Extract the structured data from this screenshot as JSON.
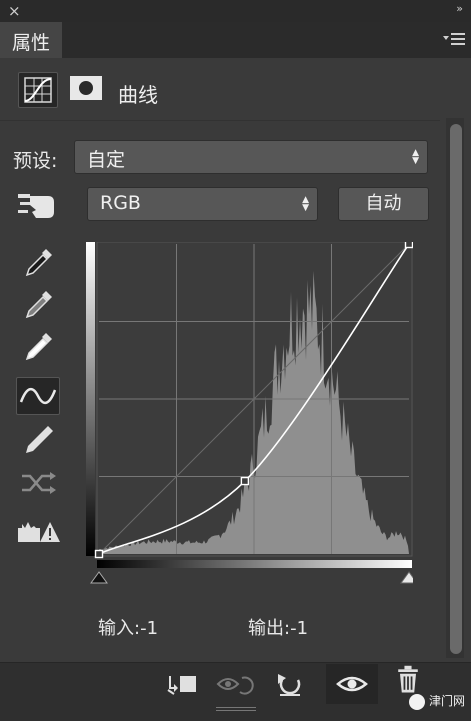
{
  "panel": {
    "close_symbol": "×",
    "collapse_symbol": "»"
  },
  "tab": {
    "label": "属性"
  },
  "header": {
    "title": "曲线"
  },
  "preset": {
    "label": "预设:",
    "value": "自定"
  },
  "channel": {
    "value": "RGB"
  },
  "auto_button": {
    "label": "自动"
  },
  "curve": {
    "input_range": [
      0,
      255
    ],
    "output_range": [
      0,
      255
    ],
    "points": [
      [
        0,
        0
      ],
      [
        120,
        60
      ],
      [
        255,
        255
      ]
    ],
    "black_point_input": 0,
    "white_point_input": 255
  },
  "io": {
    "input_label": "输入:",
    "input_value": "-1",
    "output_label": "输出:",
    "output_value": "-1"
  },
  "watermark": {
    "text": "津门网"
  },
  "icons": {
    "header": [
      "curves-adjustment-icon",
      "layer-mask-icon"
    ],
    "tools": [
      "on-image-adjust-icon",
      "sample-black-eyedropper-icon",
      "sample-gray-eyedropper-icon",
      "sample-white-eyedropper-icon",
      "curve-point-icon",
      "pencil-draw-icon",
      "smooth-curve-icon",
      "clipping-warning-icon"
    ],
    "bottom": [
      "clip-to-layer-icon",
      "view-previous-icon",
      "reset-icon",
      "visibility-eye-icon",
      "delete-trash-icon"
    ]
  },
  "colors": {
    "panel": "#3a3a3a",
    "field": "#575757",
    "graph_bg": "#3c3c3c",
    "histogram": "#8f8f8f",
    "curve": "#ffffff"
  }
}
